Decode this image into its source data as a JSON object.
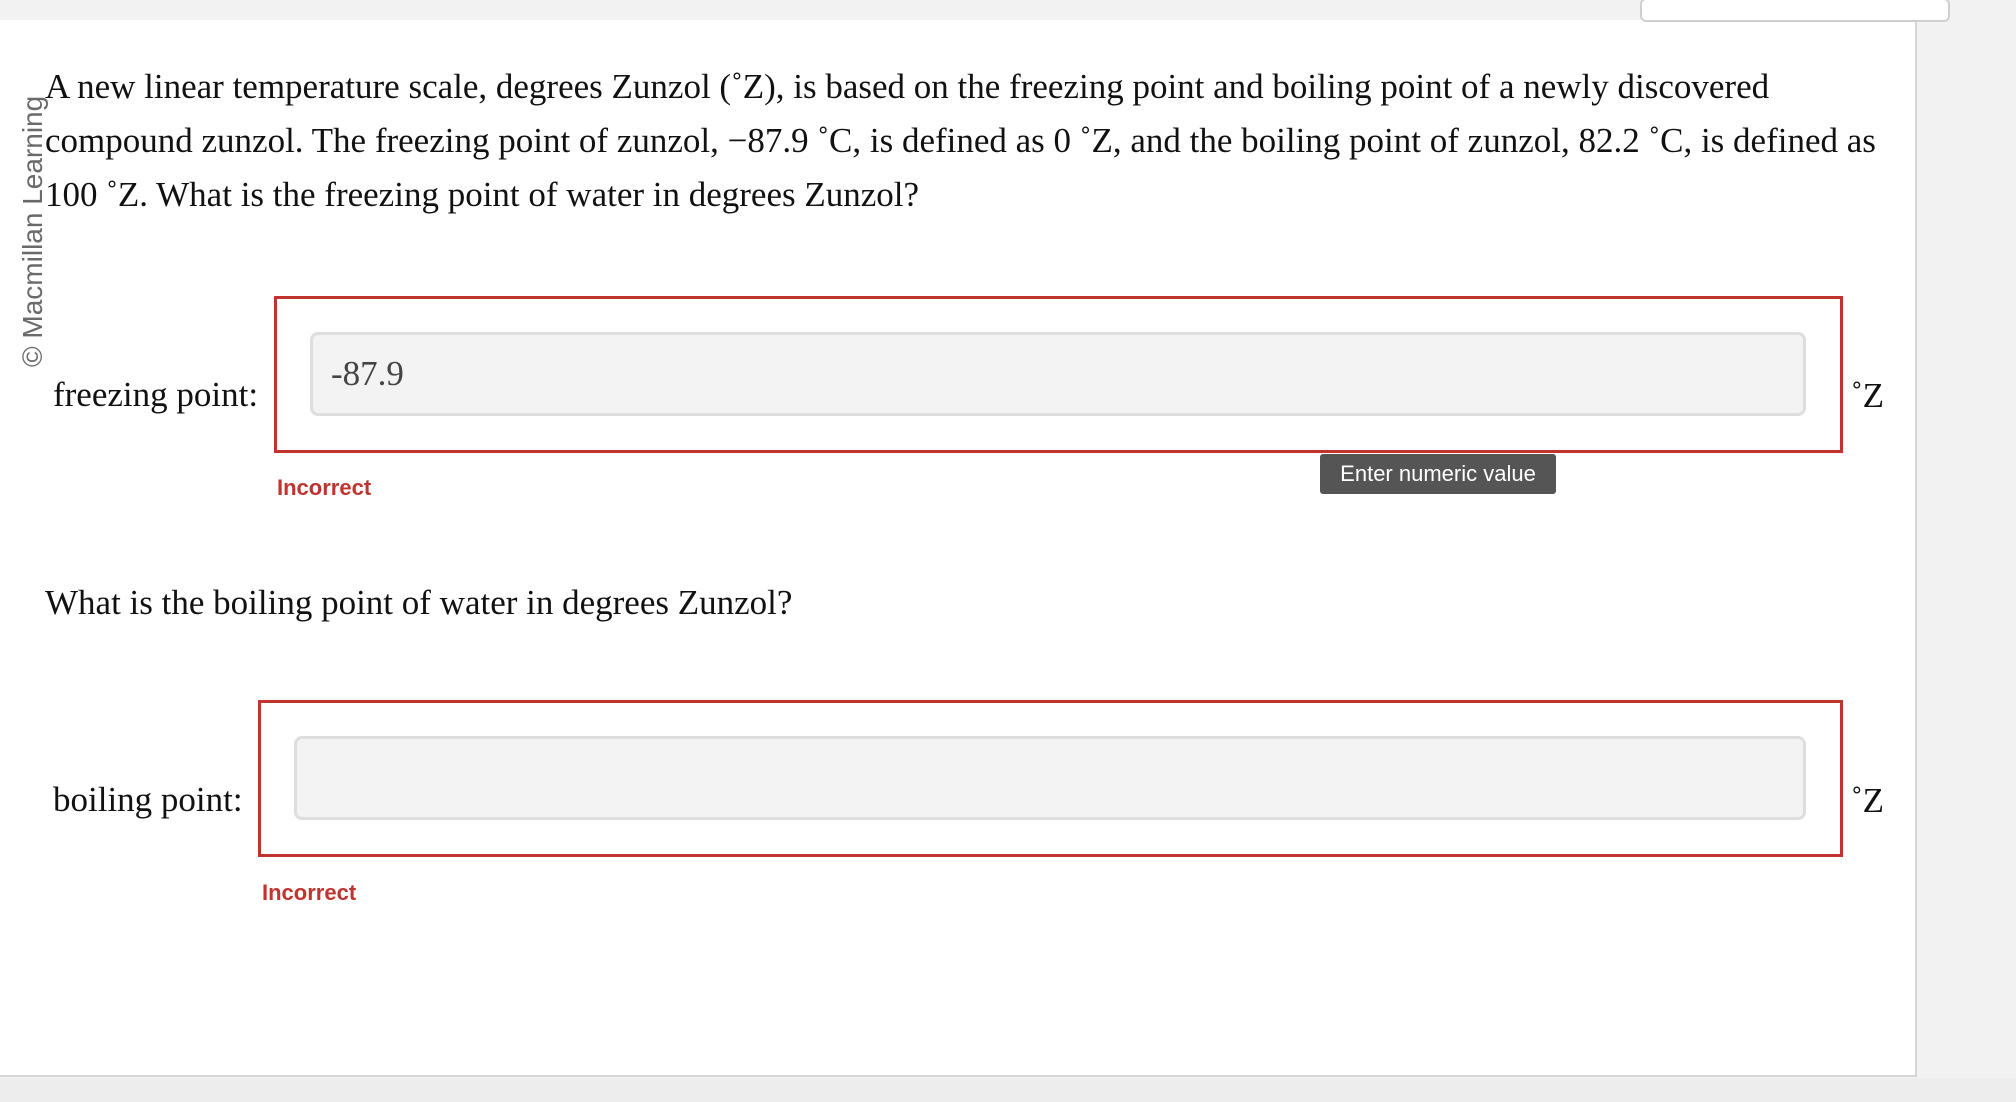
{
  "copyright": "© Macmillan Learning",
  "question1": "A new linear temperature scale, degrees Zunzol (˚Z), is based on the freezing point and boiling point of a newly discovered compound zunzol. The freezing point of zunzol, −87.9 ˚C, is defined as 0 ˚Z, and the boiling point of zunzol, 82.2 ˚C, is defined as 100 ˚Z. What is the freezing point of water in degrees Zunzol?",
  "freezing": {
    "label": "freezing point:",
    "value": "-87.9",
    "unit": "˚Z",
    "status": "Incorrect",
    "tooltip": "Enter numeric value"
  },
  "question2": "What is the boiling point of water in degrees Zunzol?",
  "boiling": {
    "label": "boiling point:",
    "value": "",
    "unit": "˚Z",
    "status": "Incorrect"
  },
  "colors": {
    "error": "#c0332f",
    "input_bg": "#f3f3f3",
    "tooltip_bg": "#555555"
  }
}
